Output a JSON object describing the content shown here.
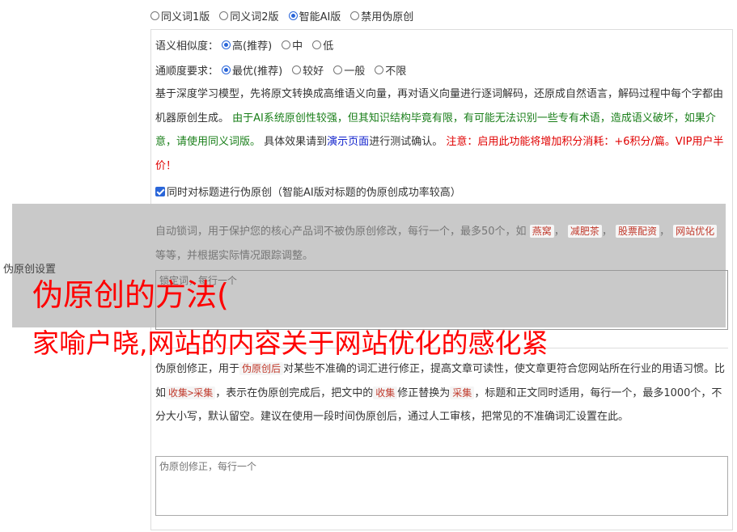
{
  "modes": [
    {
      "label": "同义词1版",
      "selected": false
    },
    {
      "label": "同义词2版",
      "selected": false
    },
    {
      "label": "智能AI版",
      "selected": true
    },
    {
      "label": "禁用伪原创",
      "selected": false
    }
  ],
  "similarity": {
    "label": "语义相似度：",
    "options": [
      "高(推荐)",
      "中",
      "低"
    ],
    "selected_index": 0
  },
  "fluency": {
    "label": "通顺度要求：",
    "options": [
      "最优(推荐)",
      "较好",
      "一般",
      "不限"
    ],
    "selected_index": 0
  },
  "desc": {
    "part1": "基于深度学习模型，先将原文转换成高维语义向量，再对语义向量进行逐词解码，还原成自然语言，解码过程中每个字都由机器原创生成。",
    "part2": "由于AI系统原创性较强，但其知识结构毕竟有限，有可能无法识别一些专有术语，造成语义破坏，如果介意，请使用同义词版。",
    "part3": "具体效果请到",
    "link": "演示页面",
    "part4": "进行测试确认。",
    "part5": "注意：启用此功能将增加积分消耗：+6积分/篇。VIP用户半价！"
  },
  "title_check": {
    "label": "同时对标题进行伪原创（智能AI版对标题的伪原创成功率较高）",
    "checked": true
  },
  "side_label": "伪原创设置",
  "lock": {
    "text_a": "自动锁词，用于保护您的核心产品词不被伪原创修改，每行一个，最多50个，如",
    "tags": [
      "燕窝",
      "减肥茶",
      "股票配资",
      "网站优化"
    ],
    "text_b": "等等，并根据实际情况跟踪调整。",
    "placeholder": "锁定词，每行一个"
  },
  "fix": {
    "t1": "伪原创修正，用于",
    "tag1": "伪原创后",
    "t2": "对某些不准确的词汇进行修正，提高文章可读性，使文章更符合您网站所在行业的用语习惯。比如",
    "tag2": "收集>采集",
    "t3": "，表示在伪原创完成后，把文中的",
    "tag3": "收集",
    "t4": "修正替换为",
    "tag4": "采集",
    "t5": "，标题和正文同时适用，每行一个，最多1000个，不分大小写，默认留空。建议在使用一段时间伪原创后，通过人工审核，把常见的不准确词汇设置在此。",
    "placeholder": "伪原创修正，每行一个"
  },
  "overlay": {
    "line1": "伪原创的方法(",
    "line2": "家喻户晓,网站的内容关于网站优化的感化紧"
  }
}
